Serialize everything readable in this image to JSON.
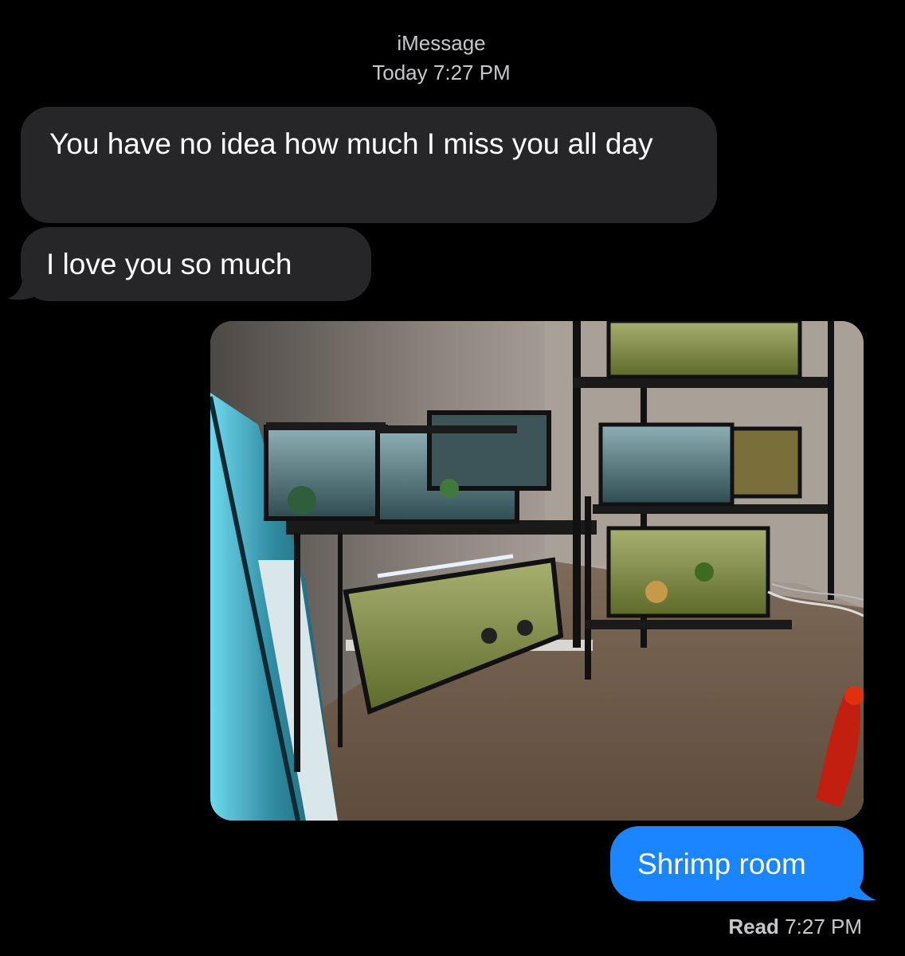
{
  "header": {
    "service": "iMessage",
    "day": "Today",
    "time": "7:27 PM"
  },
  "messages": [
    {
      "direction": "incoming",
      "text": "You have no idea how much I miss you all day"
    },
    {
      "direction": "incoming",
      "text": "I love you so much"
    },
    {
      "direction": "outgoing",
      "type": "image"
    },
    {
      "direction": "outgoing",
      "text": "Shrimp room"
    }
  ],
  "receipt": {
    "label": "Read",
    "time": "7:27 PM"
  },
  "colors": {
    "background": "#000000",
    "incoming_bubble": "#262629",
    "outgoing_bubble": "#1a85ff",
    "meta_text": "#c7c7cc"
  }
}
